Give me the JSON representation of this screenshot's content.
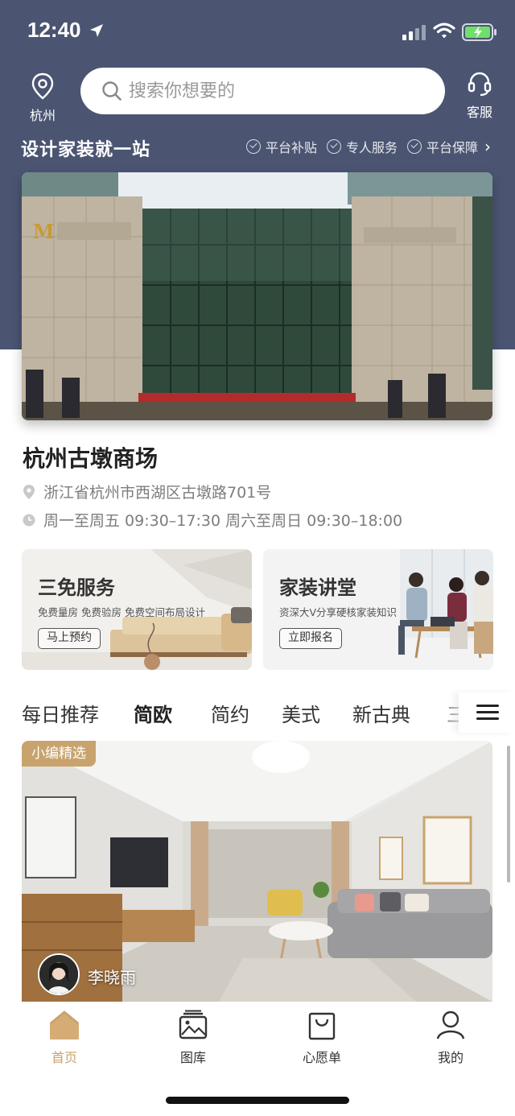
{
  "status_bar": {
    "time": "12:40"
  },
  "header": {
    "city": "杭州",
    "search_placeholder": "搜索你想要的",
    "service_label": "客服"
  },
  "slogan": "设计家装就一站",
  "badges": [
    "平台补贴",
    "专人服务",
    "平台保障"
  ],
  "store": {
    "name": "杭州古墩商场",
    "address": "浙江省杭州市西湖区古墩路701号",
    "hours": "周一至周五 09:30–17:30 周六至周日 09:30–18:00"
  },
  "promos": [
    {
      "title": "三免服务",
      "subtitle": "免费量房  免费验房  免费空间布局设计",
      "button": "马上预约"
    },
    {
      "title": "家装讲堂",
      "subtitle": "资深大V分享硬核家装知识",
      "button": "立即报名"
    }
  ],
  "tabs": [
    "每日推荐",
    "简欧",
    "简约",
    "美式",
    "新古典",
    "三"
  ],
  "active_tab": "简欧",
  "feed": {
    "tag": "小编精选",
    "author": "李晓雨"
  },
  "bottom_nav": [
    {
      "label": "首页",
      "icon": "home-icon",
      "active": true
    },
    {
      "label": "图库",
      "icon": "gallery-icon",
      "active": false
    },
    {
      "label": "心愿单",
      "icon": "wishlist-bag-icon",
      "active": false
    },
    {
      "label": "我的",
      "icon": "profile-icon",
      "active": false
    }
  ],
  "colors": {
    "header_bg": "#4b5572",
    "accent_gold": "#c9a36d",
    "tab_highlight": "#e9d3b5"
  }
}
